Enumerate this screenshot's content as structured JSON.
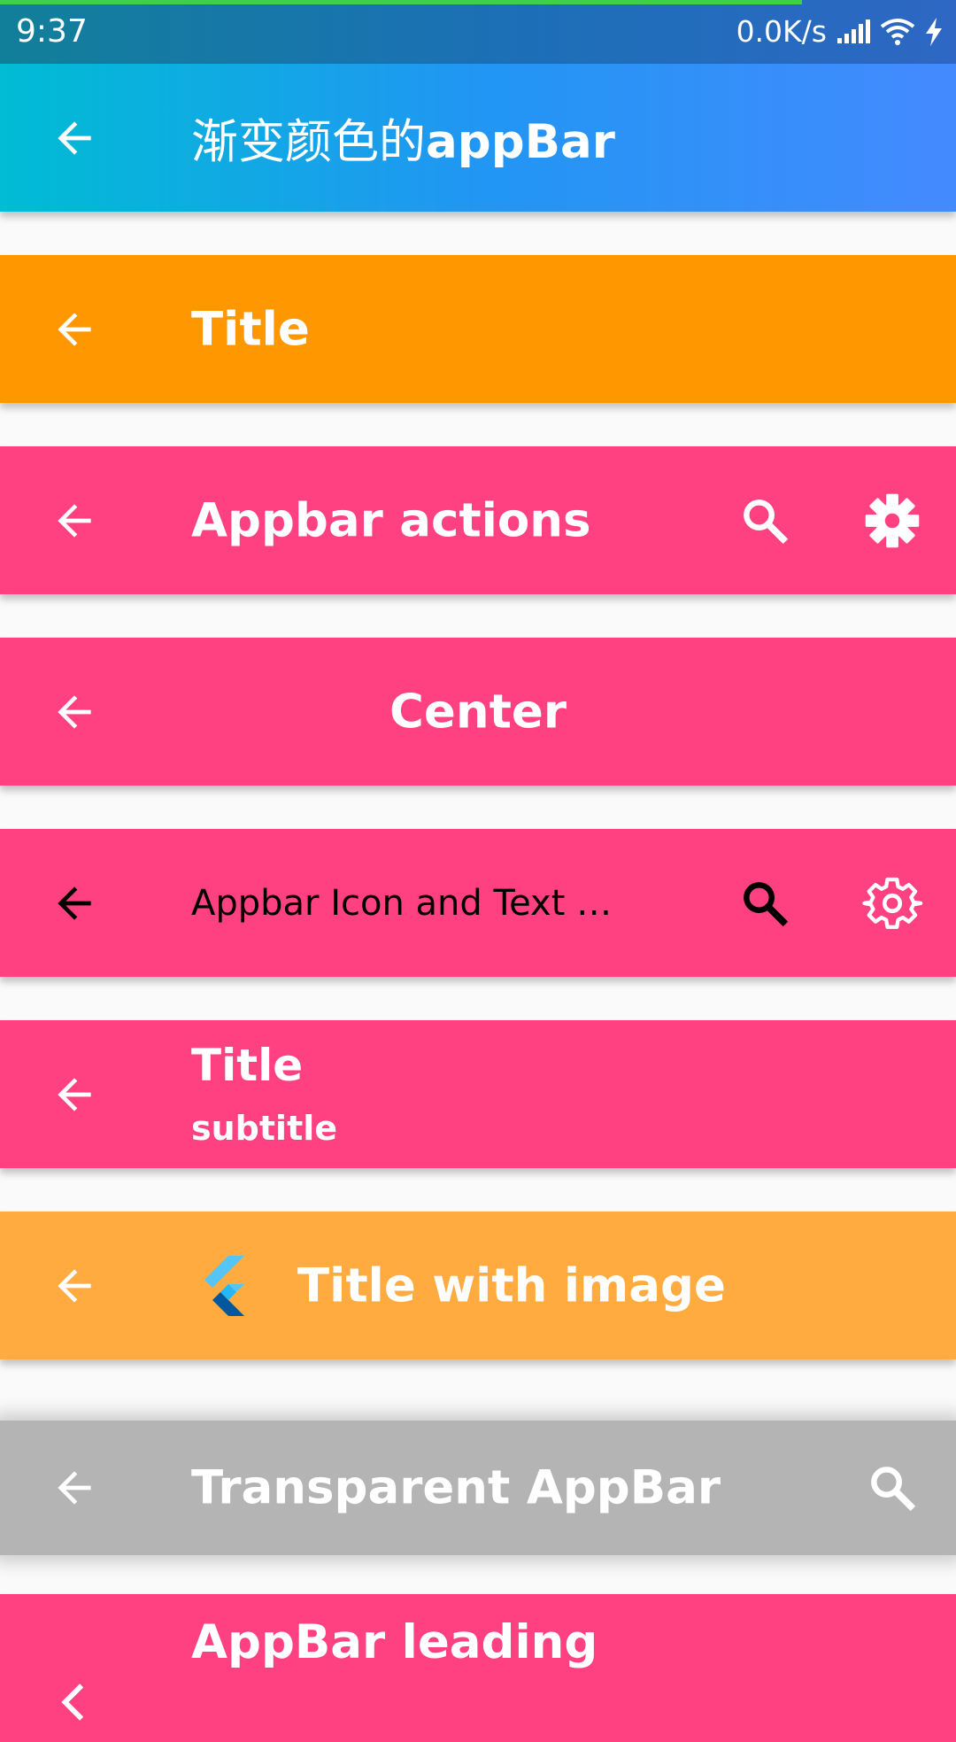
{
  "status_bar": {
    "time": "9:37",
    "net_speed": "0.0K/s",
    "icons": [
      "signal-icon",
      "wifi-icon",
      "charging-icon"
    ]
  },
  "bars": {
    "gradient": {
      "title_cjk": "渐变颜色的",
      "title_latin": "appBar",
      "colors": [
        "#00bcd4",
        "#2196f3",
        "#448aff"
      ]
    },
    "title": {
      "title": "Title",
      "color": "#ff9800"
    },
    "actions": {
      "title": "Appbar actions",
      "color": "#ff4081"
    },
    "center": {
      "title": "Center",
      "color": "#ff4081"
    },
    "icon_text": {
      "title": "Appbar Icon and Text …",
      "color": "#ff4081"
    },
    "subtitle": {
      "title": "Title",
      "subtitle": "subtitle",
      "color": "#ff4081"
    },
    "image": {
      "title": "Title with image",
      "color": "#ffab40"
    },
    "transparent": {
      "title": "Transparent AppBar",
      "color": "#b4b4b4"
    },
    "leading": {
      "title": "AppBar leading",
      "color": "#ff4081"
    }
  }
}
